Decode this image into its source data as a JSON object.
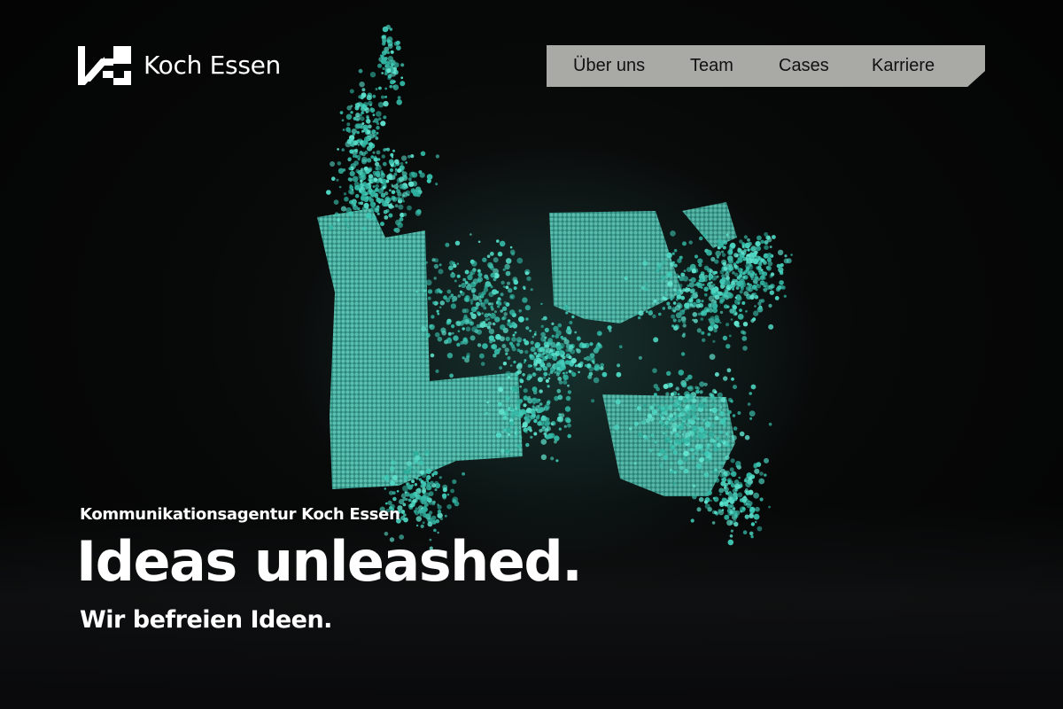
{
  "header": {
    "logo_text": "Koch Essen",
    "logo_icon": "koch-essen-logo-mark"
  },
  "nav": {
    "items": [
      {
        "label": "Über uns"
      },
      {
        "label": "Team"
      },
      {
        "label": "Cases"
      },
      {
        "label": "Karriere"
      }
    ],
    "background_color": "#a9a9a5"
  },
  "hero": {
    "eyebrow": "Kommunikationsagentur Koch Essen",
    "headline": "Ideas unleashed.",
    "subline": "Wir befreien Ideen.",
    "art_icon": "particle-logo-illustration",
    "accent_color": "#3fc9b6"
  }
}
